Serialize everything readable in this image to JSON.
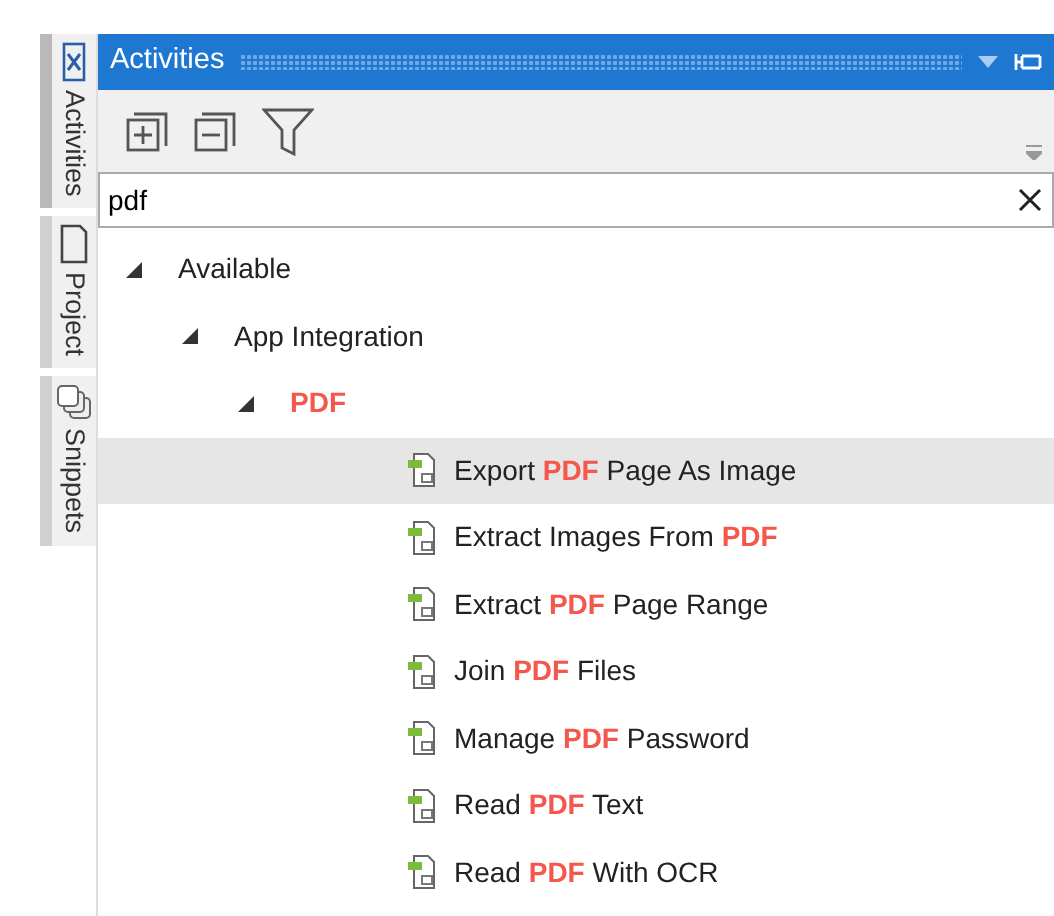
{
  "side_tabs": [
    {
      "label": "Activities",
      "selected": true
    },
    {
      "label": "Project",
      "selected": false
    },
    {
      "label": "Snippets",
      "selected": false
    }
  ],
  "panel": {
    "title": "Activities"
  },
  "search": {
    "value": "pdf"
  },
  "tree": [
    {
      "label": "Available",
      "matched": false,
      "expanded": true,
      "children": [
        {
          "label": "App Integration",
          "matched": false,
          "expanded": true,
          "children": [
            {
              "label": "PDF",
              "matched": true,
              "expanded": true,
              "children": [
                {
                  "label": "Export **PDF** Page As Image",
                  "selected": true
                },
                {
                  "label": "Extract Images From **PDF**",
                  "selected": false
                },
                {
                  "label": "Extract **PDF** Page Range",
                  "selected": false
                },
                {
                  "label": "Join **PDF** Files",
                  "selected": false
                },
                {
                  "label": "Manage **PDF** Password",
                  "selected": false
                },
                {
                  "label": "Read **PDF** Text",
                  "selected": false
                },
                {
                  "label": "Read **PDF** With OCR",
                  "selected": false
                }
              ]
            }
          ]
        }
      ]
    }
  ]
}
